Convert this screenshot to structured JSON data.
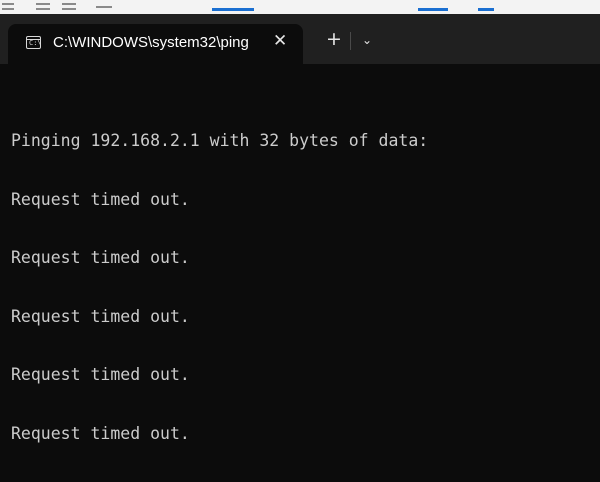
{
  "window": {
    "tab": {
      "title": "C:\\WINDOWS\\system32\\ping",
      "icon": "terminal-icon",
      "icon_glyph": "C:\\"
    },
    "close_glyph": "✕",
    "new_tab_glyph": "+",
    "dropdown_glyph": "⌄"
  },
  "terminal": {
    "lines": [
      "Pinging 192.168.2.1 with 32 bytes of data:",
      "Request timed out.",
      "Request timed out.",
      "Request timed out.",
      "Request timed out.",
      "Request timed out."
    ]
  },
  "colors": {
    "terminal_bg": "#0c0c0c",
    "titlebar_bg": "#202020",
    "text": "#cccccc"
  }
}
